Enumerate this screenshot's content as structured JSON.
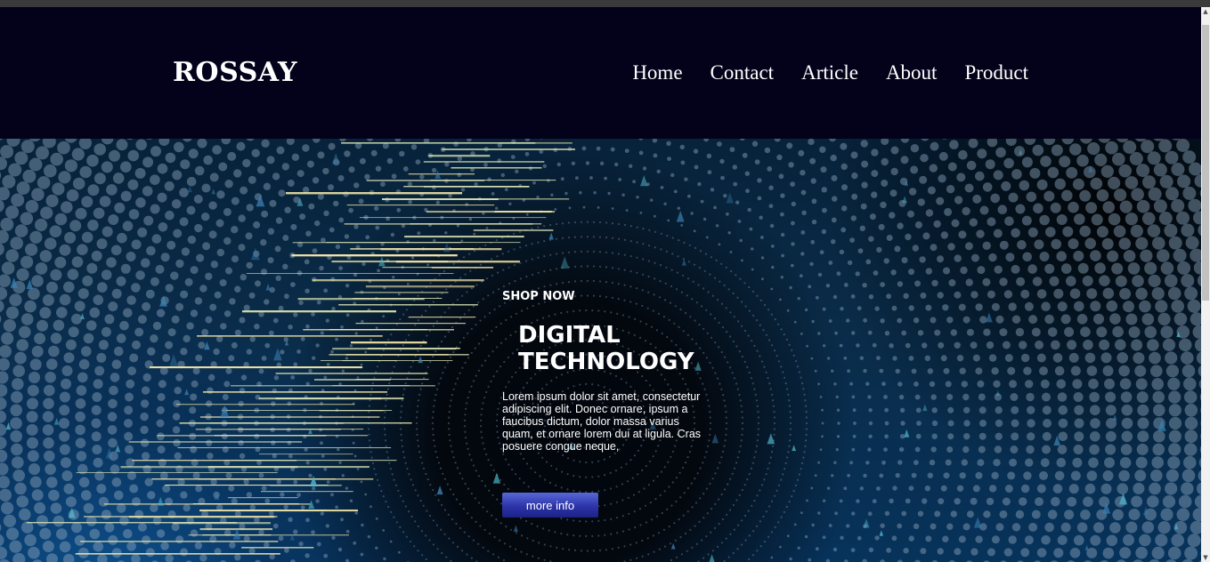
{
  "header": {
    "logo": "ROSSAY",
    "nav": [
      "Home",
      "Contact",
      "Article",
      "About",
      "Product"
    ]
  },
  "hero": {
    "eyebrow": "SHOP NOW",
    "title_line1": "DIGITAL",
    "title_line2": "TECHNOLOGY",
    "description": "Lorem ipsum dolor sit amet, consectetur adipiscing elit. Donec ornare, ipsum a faucibus dictum, dolor massa varius quam, et ornare lorem dui at ligula. Cras posuere congue neque,",
    "button_label": "more info"
  },
  "colors": {
    "header_bg": "#03021a",
    "button": "#2c34a8",
    "text": "#ffffff"
  },
  "icons": {
    "scroll_up": "triangle-up-icon",
    "scroll_down": "triangle-down-icon"
  }
}
